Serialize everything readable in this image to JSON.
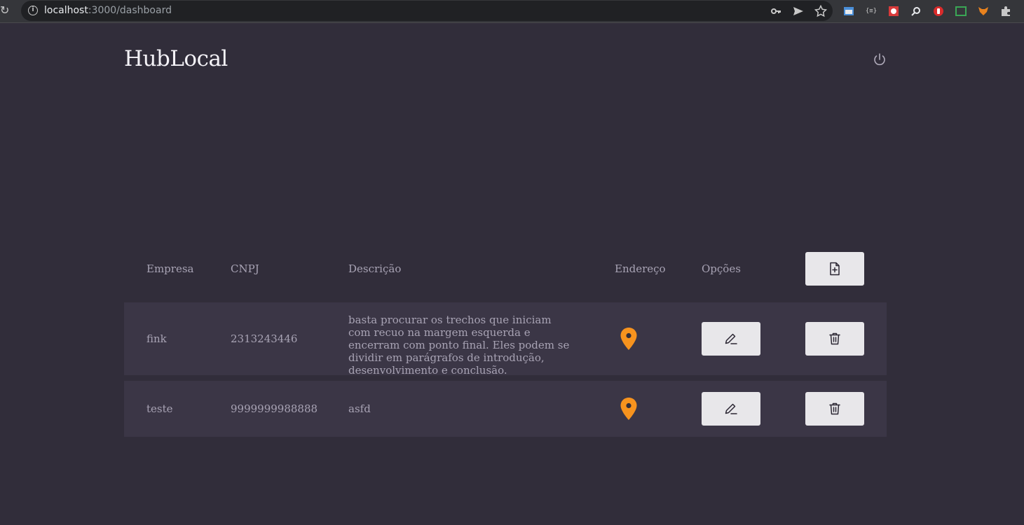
{
  "browser": {
    "url_host": "localhost",
    "url_path": ":3000/dashboard"
  },
  "app": {
    "title": "HubLocal"
  },
  "table": {
    "headers": {
      "empresa": "Empresa",
      "cnpj": "CNPJ",
      "descricao": "Descrição",
      "endereco": "Endereço",
      "opcoes": "Opções"
    },
    "rows": [
      {
        "empresa": "fink",
        "cnpj": "2313243446",
        "descricao": "basta procurar os trechos que iniciam com recuo na margem esquerda e encerram com ponto final. Eles podem se dividir em parágrafos de introdução, desenvolvimento e conclusão."
      },
      {
        "empresa": "teste",
        "cnpj": "9999999988888",
        "descricao": "asfd"
      }
    ]
  },
  "icons": {
    "logout": "power-icon",
    "add": "file-plus-icon",
    "edit": "pencil-icon",
    "delete": "trash-icon",
    "address": "map-pin-icon"
  },
  "colors": {
    "background": "#312d3a",
    "row_background": "#3b3646",
    "button_background": "#e8e7ea",
    "pin": "#f7931e"
  }
}
